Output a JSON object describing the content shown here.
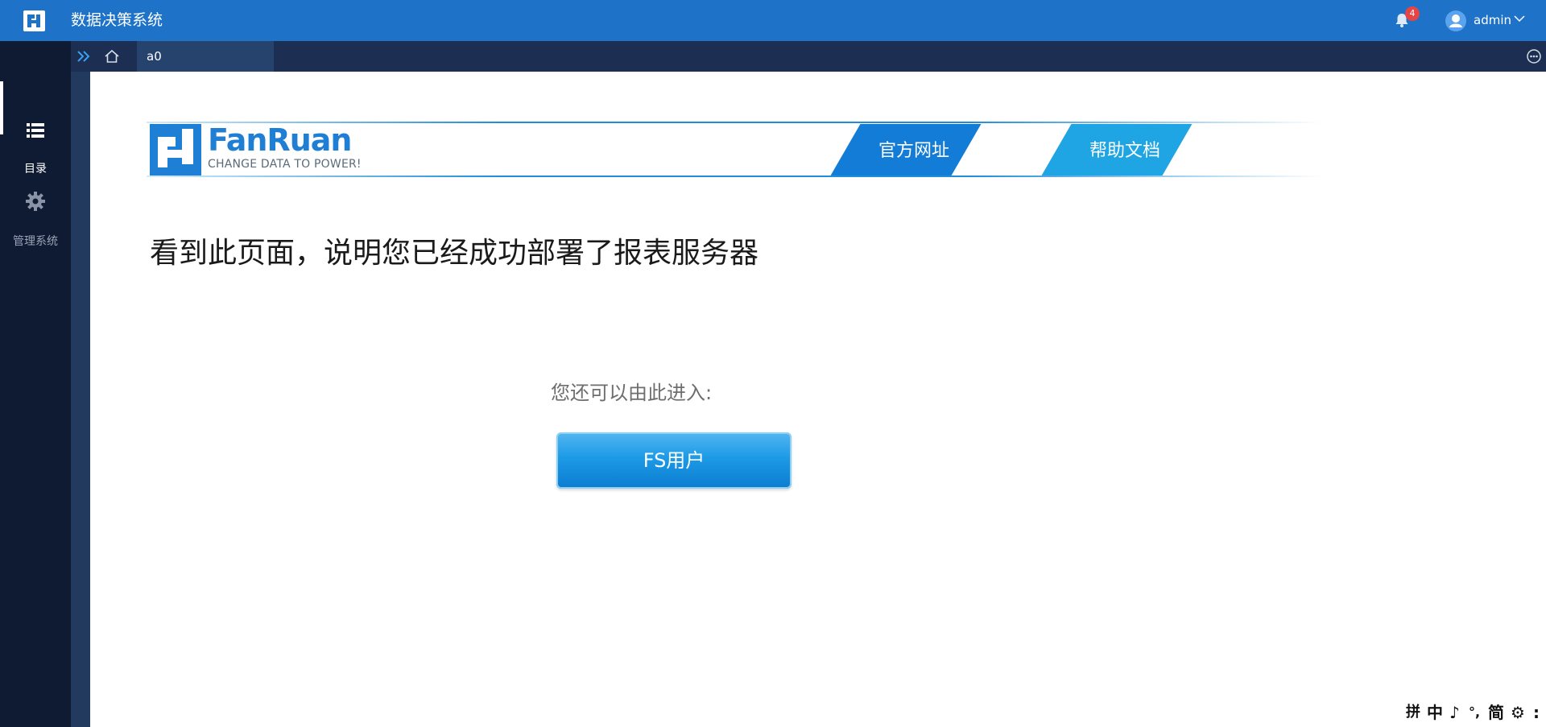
{
  "header": {
    "app_title": "数据决策系统",
    "notifications_count": "4",
    "username": "admin",
    "accent_color": "#1e73c8"
  },
  "sidebar": {
    "items": [
      {
        "label": "目录",
        "icon": "list-icon",
        "active": true
      },
      {
        "label": "管理系统",
        "icon": "gear-icon",
        "active": false
      }
    ]
  },
  "tabs": {
    "active_tab_label": "a0"
  },
  "banner": {
    "brand_name": "FanRuan",
    "tagline": "CHANGE DATA TO POWER!",
    "official_site_label": "官方网址",
    "help_docs_label": "帮助文档"
  },
  "main": {
    "headline": "看到此页面，说明您已经成功部署了报表服务器",
    "enter_prompt": "您还可以由此进入:",
    "fs_user_button": "FS用户"
  },
  "ime_toolbar": {
    "items": [
      "拼",
      "中",
      "♪",
      "°,",
      "简",
      "⚙",
      ":"
    ]
  }
}
